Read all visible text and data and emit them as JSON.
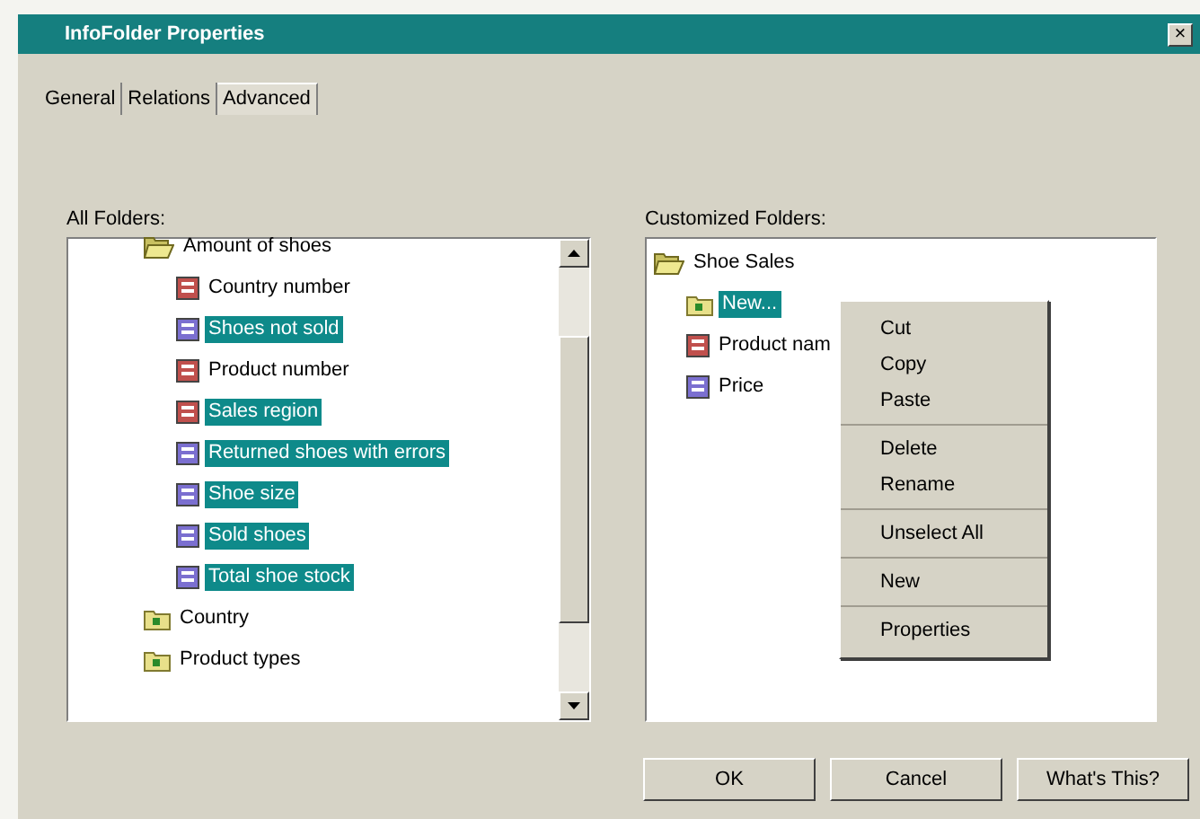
{
  "window": {
    "title": "InfoFolder Properties",
    "close": "×"
  },
  "tabs": [
    {
      "label": "General",
      "selected": false
    },
    {
      "label": "Relations",
      "selected": false
    },
    {
      "label": "Advanced",
      "selected": true
    }
  ],
  "all_folders": {
    "label": "All Folders:",
    "items": [
      {
        "label": "Amount of shoes",
        "kind": "open-folder",
        "selected": false,
        "children": [
          {
            "label": "Country number",
            "kind": "dimension",
            "selected": false
          },
          {
            "label": "Shoes not sold",
            "kind": "measure",
            "selected": true
          },
          {
            "label": "Product number",
            "kind": "dimension",
            "selected": false
          },
          {
            "label": "Sales region",
            "kind": "dimension",
            "selected": true
          },
          {
            "label": "Returned shoes with errors",
            "kind": "measure",
            "selected": true
          },
          {
            "label": "Shoe size",
            "kind": "measure",
            "selected": true
          },
          {
            "label": "Sold shoes",
            "kind": "measure",
            "selected": true
          },
          {
            "label": "Total shoe stock",
            "kind": "measure",
            "selected": true
          }
        ]
      },
      {
        "label": "Country",
        "kind": "folder",
        "selected": false
      },
      {
        "label": "Product types",
        "kind": "folder",
        "selected": false
      }
    ]
  },
  "customized_folders": {
    "label": "Customized Folders:",
    "items": [
      {
        "label": "Shoe Sales",
        "kind": "open-folder",
        "selected": false,
        "children": [
          {
            "label": "New...",
            "kind": "folder",
            "selected": true
          },
          {
            "label": "Product nam",
            "kind": "dimension",
            "selected": false
          },
          {
            "label": "Price",
            "kind": "measure",
            "selected": false
          }
        ]
      }
    ]
  },
  "context_menu": [
    [
      {
        "label": "Cut"
      },
      {
        "label": "Copy"
      },
      {
        "label": "Paste"
      }
    ],
    [
      {
        "label": "Delete"
      },
      {
        "label": "Rename"
      }
    ],
    [
      {
        "label": "Unselect All"
      }
    ],
    [
      {
        "label": "New"
      }
    ],
    [
      {
        "label": "Properties"
      }
    ]
  ],
  "buttons": [
    "OK",
    "Cancel",
    "What's This?"
  ]
}
